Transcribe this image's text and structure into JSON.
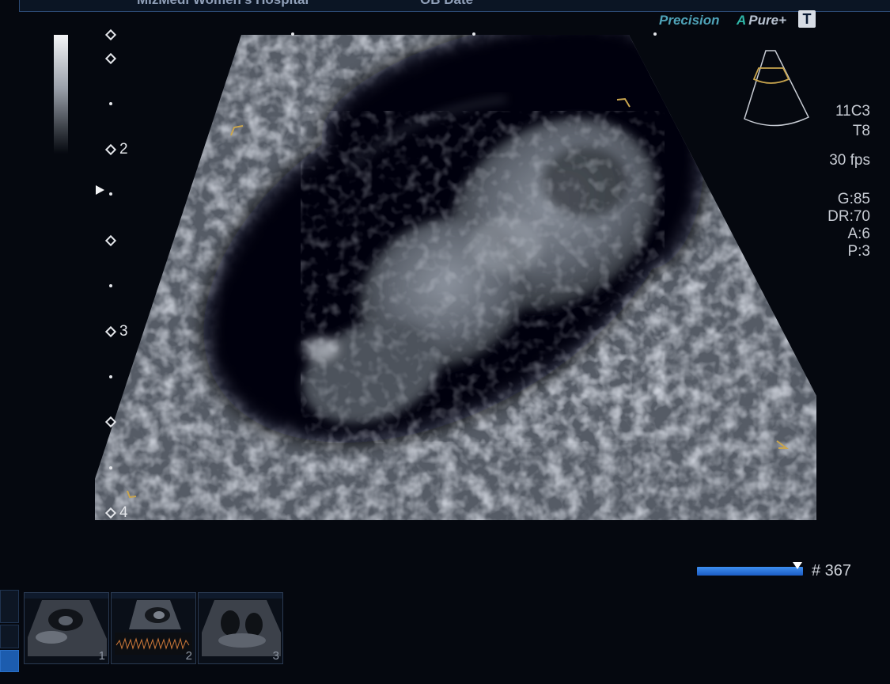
{
  "header": {
    "hospital": "MizMedi Women's Hospital",
    "study_date": "OB Date"
  },
  "brand": {
    "precision": "Precision",
    "apure_a": "A",
    "apure_rest": "Pure+",
    "t_badge": "T"
  },
  "depth_scale": {
    "labels": [
      "2",
      "3",
      "4"
    ]
  },
  "imaging_params": {
    "probe": "11C3",
    "probe_mode": "T8",
    "frame_rate": "30 fps",
    "gain": "G:85",
    "dynamic_range": "DR:70",
    "averaging": "A:6",
    "persistence": "P:3"
  },
  "cine": {
    "frame_label": "# 367",
    "position_fraction": 0.95
  },
  "thumbnails": [
    {
      "number": "1"
    },
    {
      "number": "2"
    },
    {
      "number": "3"
    }
  ],
  "colors": {
    "background": "#05080f",
    "accent_blue": "#1c5cc4",
    "roi_bracket": "#c9a54e",
    "brand_teal": "#4fa3b8"
  },
  "icons": [
    "probe-sector-icon",
    "focus-marker-icon",
    "t-badge-icon"
  ]
}
